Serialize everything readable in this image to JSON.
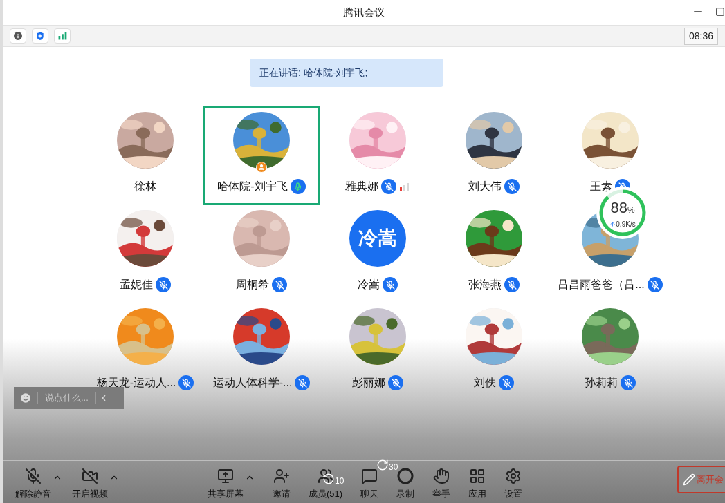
{
  "window": {
    "title": "腾讯会议"
  },
  "info_bar": {
    "time": "08:36"
  },
  "speaking_banner": "正在讲话: 哈体院-刘宇飞;",
  "participants": [
    {
      "name": "徐林",
      "selected": false,
      "host": false,
      "poor_network": false
    },
    {
      "name": "哈体院-刘宇飞",
      "selected": true,
      "muted": false,
      "host": true,
      "poor_network": false
    },
    {
      "name": "雅典娜",
      "selected": false,
      "muted": true,
      "host": false,
      "poor_network": true
    },
    {
      "name": "刘大伟",
      "selected": false,
      "muted": true,
      "host": false,
      "poor_network": false
    },
    {
      "name": "王素",
      "selected": false,
      "muted": true,
      "host": false,
      "poor_network": false
    },
    {
      "name": "孟妮佳",
      "selected": false,
      "muted": true,
      "host": false,
      "poor_network": false
    },
    {
      "name": "周桐希",
      "selected": false,
      "muted": true,
      "host": false,
      "poor_network": false
    },
    {
      "name": "冷嵩",
      "avatar": {
        "kind": "text",
        "text": "冷嵩"
      },
      "selected": false,
      "muted": true,
      "host": false,
      "poor_network": false
    },
    {
      "name": "张海燕",
      "selected": false,
      "muted": true,
      "host": false,
      "poor_network": false
    },
    {
      "name": "吕昌雨爸爸（吕...",
      "selected": false,
      "muted": true,
      "host": false,
      "poor_network": false
    },
    {
      "name": "杨天龙-运动人...",
      "selected": false,
      "muted": true,
      "host": false,
      "poor_network": false
    },
    {
      "name": "运动人体科学-...",
      "selected": false,
      "muted": true,
      "host": false,
      "poor_network": false
    },
    {
      "name": "彭丽娜",
      "selected": false,
      "muted": true,
      "host": false,
      "poor_network": false
    },
    {
      "name": "刘佚",
      "selected": false,
      "muted": true,
      "host": false,
      "poor_network": false
    },
    {
      "name": "孙莉莉",
      "selected": false,
      "muted": true,
      "host": false,
      "poor_network": false
    }
  ],
  "network_widget": {
    "percent": "88",
    "unit": "%",
    "speed": "0.9K/s",
    "level": 0.88
  },
  "chat_input": {
    "placeholder": "说点什么..."
  },
  "replay_controls": {
    "back": "10",
    "forward": "30"
  },
  "toolbar": [
    {
      "kind": "unmute",
      "label": "解除静音",
      "menu": true
    },
    {
      "kind": "video",
      "label": "开启视频",
      "menu": true
    },
    {
      "kind": "share",
      "label": "共享屏幕",
      "menu": true
    },
    {
      "kind": "invite",
      "label": "邀请",
      "menu": false
    },
    {
      "kind": "members",
      "label": "成员(51)",
      "menu": false
    },
    {
      "kind": "chat",
      "label": "聊天",
      "menu": false
    },
    {
      "kind": "record",
      "label": "录制",
      "menu": false
    },
    {
      "kind": "hand",
      "label": "举手",
      "menu": false
    },
    {
      "kind": "apps",
      "label": "应用",
      "menu": false
    },
    {
      "kind": "settings",
      "label": "设置",
      "menu": false
    }
  ],
  "leave_button": "离开会"
}
